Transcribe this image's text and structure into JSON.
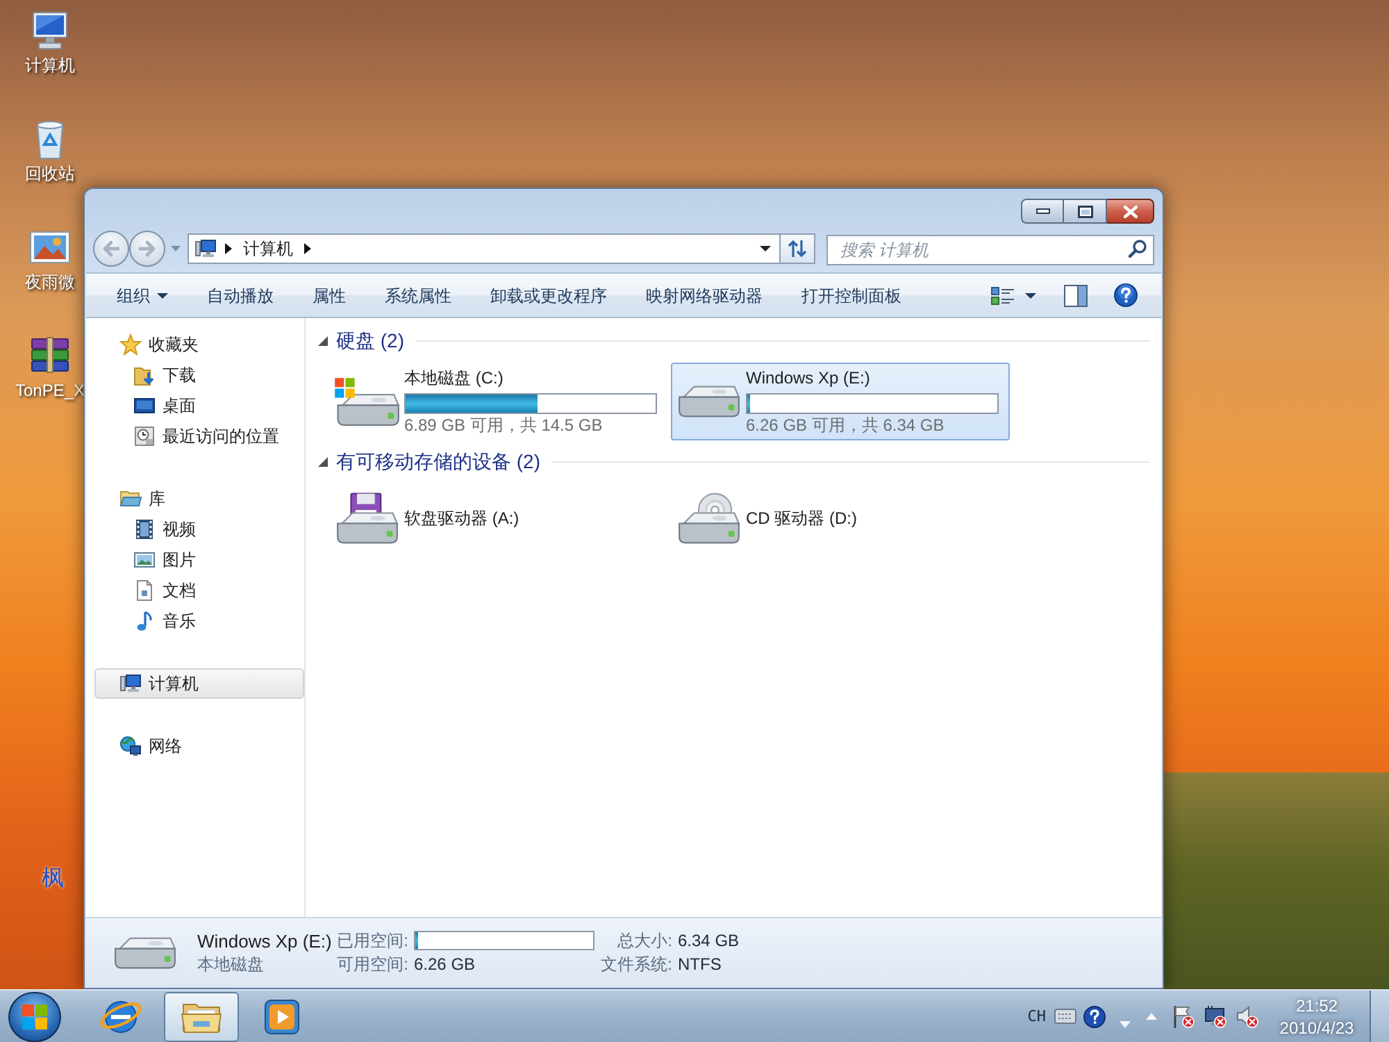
{
  "desktop": {
    "icons": [
      {
        "kind": "computer",
        "label": "计算机"
      },
      {
        "kind": "recycle-bin",
        "label": "回收站"
      },
      {
        "kind": "picture",
        "label": "夜雨微"
      },
      {
        "kind": "archive",
        "label": "TonPE_X"
      }
    ],
    "partial_label": "枫"
  },
  "navigation": {
    "back": {
      "disabled": true
    },
    "forward": {
      "disabled": true
    }
  },
  "address_bar": {
    "path": [
      "计算机"
    ]
  },
  "search": {
    "placeholder": "搜索 计算机"
  },
  "toolbar": {
    "items": [
      {
        "label": "组织",
        "dropdown": true
      },
      {
        "label": "自动播放",
        "dropdown": false
      },
      {
        "label": "属性",
        "dropdown": false
      },
      {
        "label": "系统属性",
        "dropdown": false
      },
      {
        "label": "卸载或更改程序",
        "dropdown": false
      },
      {
        "label": "映射网络驱动器",
        "dropdown": false
      },
      {
        "label": "打开控制面板",
        "dropdown": false
      }
    ]
  },
  "sidebar": {
    "items": [
      {
        "kind": "favorites",
        "label": "收藏夹",
        "selected": false,
        "children": [
          {
            "kind": "downloads",
            "label": "下载",
            "selected": false
          },
          {
            "kind": "desktop",
            "label": "桌面",
            "selected": false
          },
          {
            "kind": "recent",
            "label": "最近访问的位置",
            "selected": false
          }
        ]
      },
      {
        "kind": "libraries",
        "label": "库",
        "selected": false,
        "children": [
          {
            "kind": "videos",
            "label": "视频",
            "selected": false
          },
          {
            "kind": "pictures",
            "label": "图片",
            "selected": false
          },
          {
            "kind": "documents",
            "label": "文档",
            "selected": false
          },
          {
            "kind": "music",
            "label": "音乐",
            "selected": false
          }
        ]
      },
      {
        "kind": "computer",
        "label": "计算机",
        "selected": true
      },
      {
        "kind": "network",
        "label": "网络",
        "selected": false
      }
    ]
  },
  "content": {
    "groups": [
      {
        "title": "硬盘 (2)",
        "expanded": true,
        "items": [
          {
            "kind": "system-drive",
            "name": "本地磁盘 (C:)",
            "level": 0.525,
            "space": "6.89 GB 可用，共 14.5 GB",
            "selected": false
          },
          {
            "kind": "hard-drive",
            "name": "Windows Xp (E:)",
            "level": 0.013,
            "space": "6.26 GB 可用，共 6.34 GB",
            "selected": true
          }
        ]
      },
      {
        "title": "有可移动存储的设备 (2)",
        "expanded": true,
        "items": [
          {
            "kind": "floppy",
            "name": "软盘驱动器 (A:)",
            "selected": false
          },
          {
            "kind": "cd",
            "name": "CD 驱动器 (D:)",
            "selected": false
          }
        ]
      }
    ]
  },
  "details": {
    "kind": "hard-drive",
    "name": "Windows Xp (E:)",
    "type": "本地磁盘",
    "fields": [
      {
        "label": "已用空间:",
        "kind": "bar",
        "level": 0.013
      },
      {
        "label": "总大小:",
        "kind": "text",
        "value": "6.34 GB"
      },
      {
        "label": "可用空间:",
        "kind": "text",
        "value": "6.26 GB"
      },
      {
        "label": "文件系统:",
        "kind": "text",
        "value": "NTFS"
      }
    ]
  },
  "taskbar": {
    "items": [
      {
        "kind": "browser",
        "selected": false
      },
      {
        "kind": "folder",
        "selected": true
      },
      {
        "kind": "media",
        "selected": false
      }
    ],
    "language": "CH",
    "time": "21:52",
    "date": "2010/4/23"
  }
}
